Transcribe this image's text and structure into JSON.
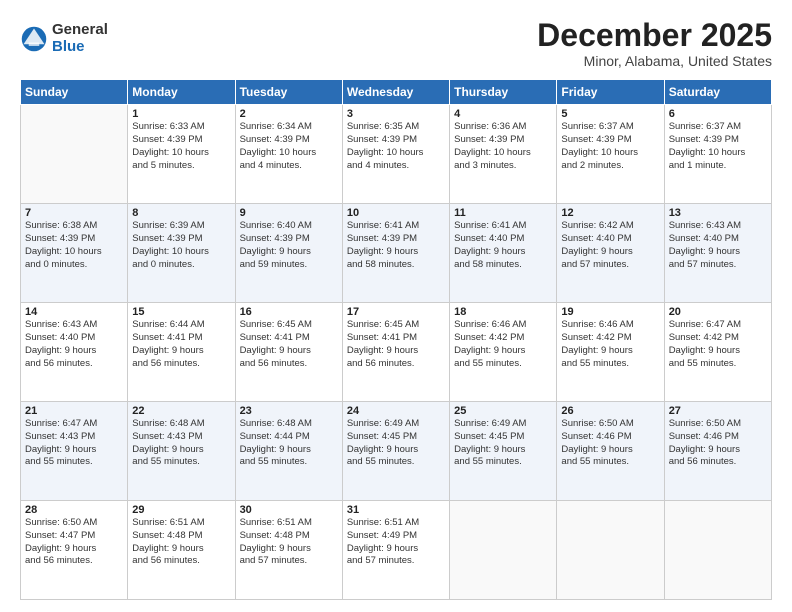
{
  "logo": {
    "general": "General",
    "blue": "Blue"
  },
  "title": "December 2025",
  "location": "Minor, Alabama, United States",
  "weekdays": [
    "Sunday",
    "Monday",
    "Tuesday",
    "Wednesday",
    "Thursday",
    "Friday",
    "Saturday"
  ],
  "weeks": [
    [
      {
        "day": "",
        "info": ""
      },
      {
        "day": "1",
        "info": "Sunrise: 6:33 AM\nSunset: 4:39 PM\nDaylight: 10 hours\nand 5 minutes."
      },
      {
        "day": "2",
        "info": "Sunrise: 6:34 AM\nSunset: 4:39 PM\nDaylight: 10 hours\nand 4 minutes."
      },
      {
        "day": "3",
        "info": "Sunrise: 6:35 AM\nSunset: 4:39 PM\nDaylight: 10 hours\nand 4 minutes."
      },
      {
        "day": "4",
        "info": "Sunrise: 6:36 AM\nSunset: 4:39 PM\nDaylight: 10 hours\nand 3 minutes."
      },
      {
        "day": "5",
        "info": "Sunrise: 6:37 AM\nSunset: 4:39 PM\nDaylight: 10 hours\nand 2 minutes."
      },
      {
        "day": "6",
        "info": "Sunrise: 6:37 AM\nSunset: 4:39 PM\nDaylight: 10 hours\nand 1 minute."
      }
    ],
    [
      {
        "day": "7",
        "info": "Sunrise: 6:38 AM\nSunset: 4:39 PM\nDaylight: 10 hours\nand 0 minutes."
      },
      {
        "day": "8",
        "info": "Sunrise: 6:39 AM\nSunset: 4:39 PM\nDaylight: 10 hours\nand 0 minutes."
      },
      {
        "day": "9",
        "info": "Sunrise: 6:40 AM\nSunset: 4:39 PM\nDaylight: 9 hours\nand 59 minutes."
      },
      {
        "day": "10",
        "info": "Sunrise: 6:41 AM\nSunset: 4:39 PM\nDaylight: 9 hours\nand 58 minutes."
      },
      {
        "day": "11",
        "info": "Sunrise: 6:41 AM\nSunset: 4:40 PM\nDaylight: 9 hours\nand 58 minutes."
      },
      {
        "day": "12",
        "info": "Sunrise: 6:42 AM\nSunset: 4:40 PM\nDaylight: 9 hours\nand 57 minutes."
      },
      {
        "day": "13",
        "info": "Sunrise: 6:43 AM\nSunset: 4:40 PM\nDaylight: 9 hours\nand 57 minutes."
      }
    ],
    [
      {
        "day": "14",
        "info": "Sunrise: 6:43 AM\nSunset: 4:40 PM\nDaylight: 9 hours\nand 56 minutes."
      },
      {
        "day": "15",
        "info": "Sunrise: 6:44 AM\nSunset: 4:41 PM\nDaylight: 9 hours\nand 56 minutes."
      },
      {
        "day": "16",
        "info": "Sunrise: 6:45 AM\nSunset: 4:41 PM\nDaylight: 9 hours\nand 56 minutes."
      },
      {
        "day": "17",
        "info": "Sunrise: 6:45 AM\nSunset: 4:41 PM\nDaylight: 9 hours\nand 56 minutes."
      },
      {
        "day": "18",
        "info": "Sunrise: 6:46 AM\nSunset: 4:42 PM\nDaylight: 9 hours\nand 55 minutes."
      },
      {
        "day": "19",
        "info": "Sunrise: 6:46 AM\nSunset: 4:42 PM\nDaylight: 9 hours\nand 55 minutes."
      },
      {
        "day": "20",
        "info": "Sunrise: 6:47 AM\nSunset: 4:42 PM\nDaylight: 9 hours\nand 55 minutes."
      }
    ],
    [
      {
        "day": "21",
        "info": "Sunrise: 6:47 AM\nSunset: 4:43 PM\nDaylight: 9 hours\nand 55 minutes."
      },
      {
        "day": "22",
        "info": "Sunrise: 6:48 AM\nSunset: 4:43 PM\nDaylight: 9 hours\nand 55 minutes."
      },
      {
        "day": "23",
        "info": "Sunrise: 6:48 AM\nSunset: 4:44 PM\nDaylight: 9 hours\nand 55 minutes."
      },
      {
        "day": "24",
        "info": "Sunrise: 6:49 AM\nSunset: 4:45 PM\nDaylight: 9 hours\nand 55 minutes."
      },
      {
        "day": "25",
        "info": "Sunrise: 6:49 AM\nSunset: 4:45 PM\nDaylight: 9 hours\nand 55 minutes."
      },
      {
        "day": "26",
        "info": "Sunrise: 6:50 AM\nSunset: 4:46 PM\nDaylight: 9 hours\nand 55 minutes."
      },
      {
        "day": "27",
        "info": "Sunrise: 6:50 AM\nSunset: 4:46 PM\nDaylight: 9 hours\nand 56 minutes."
      }
    ],
    [
      {
        "day": "28",
        "info": "Sunrise: 6:50 AM\nSunset: 4:47 PM\nDaylight: 9 hours\nand 56 minutes."
      },
      {
        "day": "29",
        "info": "Sunrise: 6:51 AM\nSunset: 4:48 PM\nDaylight: 9 hours\nand 56 minutes."
      },
      {
        "day": "30",
        "info": "Sunrise: 6:51 AM\nSunset: 4:48 PM\nDaylight: 9 hours\nand 57 minutes."
      },
      {
        "day": "31",
        "info": "Sunrise: 6:51 AM\nSunset: 4:49 PM\nDaylight: 9 hours\nand 57 minutes."
      },
      {
        "day": "",
        "info": ""
      },
      {
        "day": "",
        "info": ""
      },
      {
        "day": "",
        "info": ""
      }
    ]
  ]
}
